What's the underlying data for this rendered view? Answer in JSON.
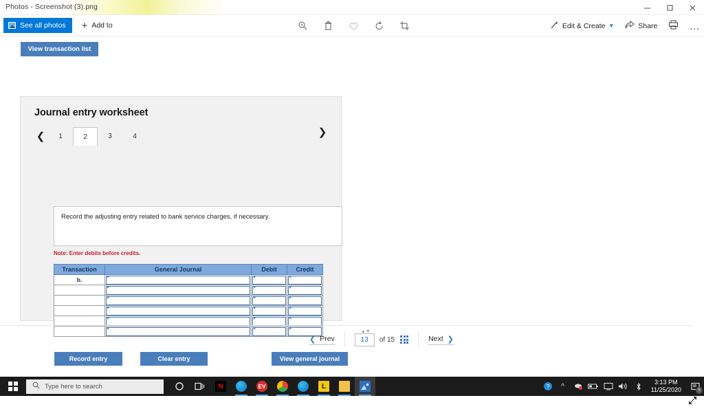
{
  "window": {
    "title": "Photos - Screenshot (3).png",
    "controls": {
      "minimize": "minimize-icon",
      "maximize": "maximize-icon",
      "close": "close-icon"
    }
  },
  "toolbar": {
    "see_all_photos": "See all photos",
    "add_to": "Add to",
    "center_icons": [
      "zoom-icon",
      "delete-icon",
      "favorite-icon",
      "rotate-icon",
      "crop-icon"
    ],
    "edit_create": "Edit & Create",
    "share": "Share",
    "print": "print-icon",
    "more": "..."
  },
  "content": {
    "view_transaction_list": "View transaction list",
    "panel_title": "Journal entry worksheet",
    "tabs": [
      "1",
      "2",
      "3",
      "4"
    ],
    "active_tab": "2",
    "instruction": "Record the adjusting entry related to bank service charges, if necessary.",
    "note": "Note: Enter debits before credits.",
    "table": {
      "headers": [
        "Transaction",
        "General Journal",
        "Debit",
        "Credit"
      ],
      "rows": [
        {
          "transaction": "b.",
          "general_journal": "",
          "debit": "",
          "credit": ""
        },
        {
          "transaction": "",
          "general_journal": "",
          "debit": "",
          "credit": ""
        },
        {
          "transaction": "",
          "general_journal": "",
          "debit": "",
          "credit": ""
        },
        {
          "transaction": "",
          "general_journal": "",
          "debit": "",
          "credit": ""
        },
        {
          "transaction": "",
          "general_journal": "",
          "debit": "",
          "credit": ""
        },
        {
          "transaction": "",
          "general_journal": "",
          "debit": "",
          "credit": ""
        }
      ]
    },
    "buttons": {
      "record_entry": "Record entry",
      "clear_entry": "Clear entry",
      "view_general_journal": "View general journal"
    },
    "accent_color": "#4a7ebb",
    "header_color": "#7fa9dd",
    "note_color": "#c32026"
  },
  "pagination": {
    "prev": "Prev",
    "current_page": "13",
    "of_label": "of",
    "total_pages": "15",
    "next": "Next",
    "grid_icon": "grid-view-icon"
  },
  "taskbar": {
    "start": "windows-start-icon",
    "search_placeholder": "Type here to search",
    "cortana": "cortana-icon",
    "task_view": "task-view-icon",
    "apps": [
      "N",
      "e",
      "EV",
      "C",
      "e",
      "L",
      "folder",
      "photos"
    ],
    "tray_icons": [
      "help-icon",
      "show-hidden-icon",
      "mic-muted-icon",
      "battery-icon",
      "display-icon",
      "volume-icon",
      "bluetooth-icon"
    ],
    "time": "3:13 PM",
    "date": "11/25/2020",
    "notification_count": "5"
  }
}
